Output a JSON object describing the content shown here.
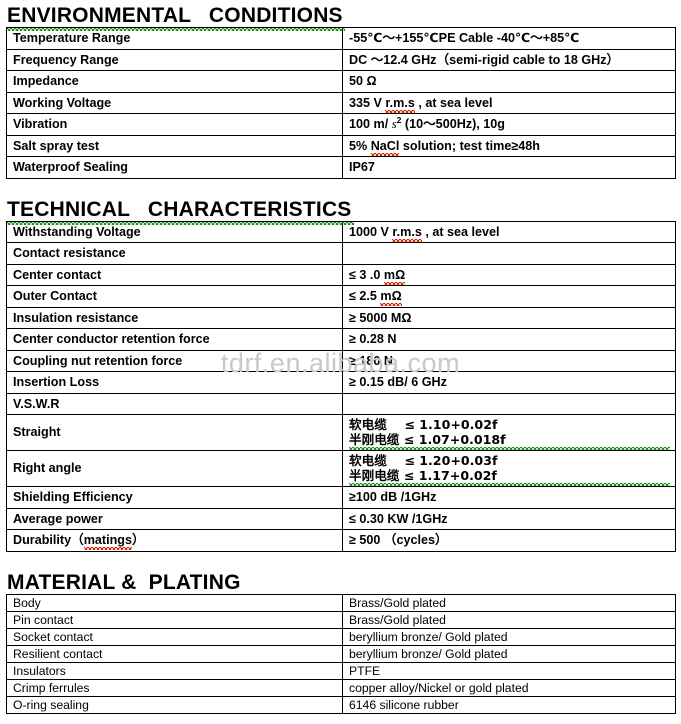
{
  "watermark": {
    "text": "tdrf.en.alibaba.com"
  },
  "sections": [
    {
      "heading": "ENVIRONMENTAL   CONDITIONS",
      "rows": [
        {
          "label": "Temperature Range",
          "value": "-55℃～+155℃PE Cable -40℃～+85℃"
        },
        {
          "label": "Frequency Range",
          "value": "DC ～12.4 GHz（semi-rigid cable to 18 GHz）"
        },
        {
          "label": "Impedance",
          "value": "50 Ω"
        },
        {
          "label": "Working Voltage",
          "value_pre": "335 V    ",
          "value_sq": "r.m.s",
          "value_post": " , at sea level"
        },
        {
          "label": "Vibration",
          "value_pre": "100 m/ ",
          "value_italic": "s",
          "value_sup": "2",
          "value_post": "  (10～500Hz),    10g"
        },
        {
          "label": "Salt spray test",
          "value_pre": "5% ",
          "value_sq": "NaCl",
          "value_post": " solution; test time≥48h"
        },
        {
          "label": "Waterproof Sealing",
          "value": "IP67"
        }
      ]
    },
    {
      "heading": "TECHNICAL   CHARACTERISTICS",
      "rows": [
        {
          "label": "Withstanding Voltage",
          "value_pre": "1000 V    ",
          "value_sq": "r.m.s",
          "value_post": " , at sea level"
        },
        {
          "label": "Contact resistance",
          "value": ""
        },
        {
          "label": "Center contact",
          "value_pre": "≤ 3 .0 ",
          "value_sq": "mΩ",
          "value_post": ""
        },
        {
          "label": "Outer Contact",
          "value_pre": "≤ 2.5 ",
          "value_sq": "mΩ",
          "value_post": ""
        },
        {
          "label": "Insulation resistance",
          "value": "≥ 5000 MΩ"
        },
        {
          "label": "Center conductor retention force",
          "value": "≥ 0.28 N"
        },
        {
          "label": "Coupling nut retention force",
          "value": "≥ 180 N"
        },
        {
          "label": "Insertion Loss",
          "value": "≥ 0.15 dB/ 6 GHz"
        },
        {
          "label": "V.S.W.R",
          "value": ""
        },
        {
          "label": "Straight",
          "line1": "软电缆    ≤ 1.10+0.02f",
          "line2": "半刚电缆 ≤ 1.07+0.018f",
          "tall": true
        },
        {
          "label": "Right angle",
          "line1": "软电缆    ≤ 1.20+0.03f",
          "line2": "半刚电缆 ≤ 1.17+0.02f",
          "tall": true
        },
        {
          "label": "Shielding Efficiency",
          "value": "≥100 dB /1GHz"
        },
        {
          "label": "Average power",
          "value": "≤ 0.30 KW /1GHz"
        },
        {
          "label": "Durability（matings）",
          "value": "≥ 500 （cycles）",
          "label_sq": "matings"
        }
      ]
    },
    {
      "heading": "MATERIAL &  PLATING",
      "rows": [
        {
          "label": "Body",
          "value": "Brass/Gold plated"
        },
        {
          "label": "Pin contact",
          "value": "Brass/Gold plated"
        },
        {
          "label": "Socket contact",
          "value": "beryllium bronze/ Gold plated"
        },
        {
          "label": "Resilient contact",
          "value": "beryllium bronze/ Gold plated"
        },
        {
          "label": "Insulators",
          "value": "PTFE"
        },
        {
          "label": "Crimp ferrules",
          "value": "copper alloy/Nickel or gold plated"
        },
        {
          "label": "O-ring sealing",
          "value": "6146 silicone rubber"
        }
      ]
    }
  ]
}
